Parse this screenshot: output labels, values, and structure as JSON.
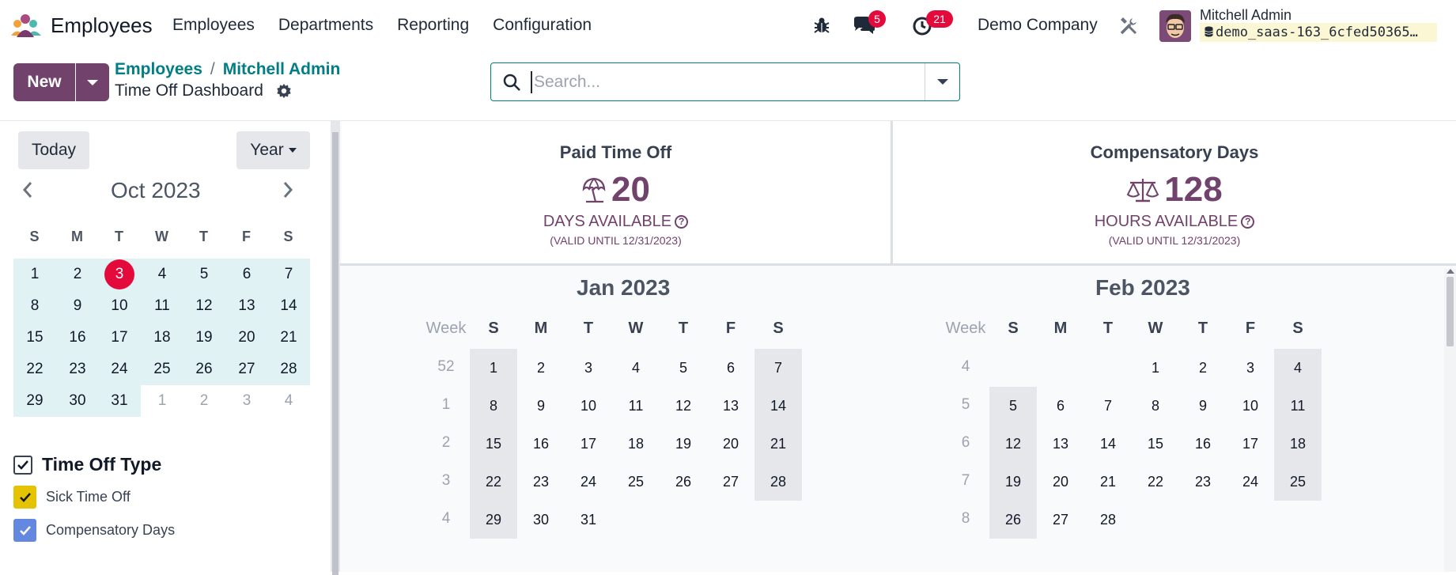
{
  "navbar": {
    "app_name": "Employees",
    "menu": [
      "Employees",
      "Departments",
      "Reporting",
      "Configuration"
    ],
    "messages_count": "5",
    "activities_count": "21",
    "company": "Demo Company",
    "user_name": "Mitchell Admin",
    "database": "demo_saas-163_6cfed50365…"
  },
  "control_panel": {
    "new_label": "New",
    "breadcrumb_parent": "Employees",
    "breadcrumb_sep": "/",
    "breadcrumb_current": "Mitchell Admin",
    "page_title": "Time Off Dashboard",
    "search_placeholder": "Search..."
  },
  "sidebar": {
    "today_label": "Today",
    "scale_label": "Year",
    "mini_month": "Oct 2023",
    "weekdays": [
      "S",
      "M",
      "T",
      "W",
      "T",
      "F",
      "S"
    ],
    "weeks": [
      [
        "1",
        "2",
        "3",
        "4",
        "5",
        "6",
        "7"
      ],
      [
        "8",
        "9",
        "10",
        "11",
        "12",
        "13",
        "14"
      ],
      [
        "15",
        "16",
        "17",
        "18",
        "19",
        "20",
        "21"
      ],
      [
        "22",
        "23",
        "24",
        "25",
        "26",
        "27",
        "28"
      ],
      [
        "29",
        "30",
        "31",
        "1",
        "2",
        "3",
        "4"
      ]
    ],
    "today_day": "3",
    "filter_title": "Time Off Type",
    "filters": [
      {
        "label": "Sick Time Off",
        "color": "#e6c300"
      },
      {
        "label": "Compensatory Days",
        "color": "#6488e0"
      }
    ]
  },
  "stats": [
    {
      "name": "Paid Time Off",
      "value": "20",
      "unit": "DAYS AVAILABLE",
      "valid": "(VALID UNTIL 12/31/2023)",
      "icon": "umbrella-icon"
    },
    {
      "name": "Compensatory Days",
      "value": "128",
      "unit": "HOURS AVAILABLE",
      "valid": "(VALID UNTIL 12/31/2023)",
      "icon": "scale-icon"
    }
  ],
  "calendar": {
    "week_label": "Week",
    "weekdays": [
      "S",
      "M",
      "T",
      "W",
      "T",
      "F",
      "S"
    ],
    "months": [
      {
        "title": "Jan 2023",
        "weeks": [
          {
            "num": "52",
            "days": [
              "1",
              "2",
              "3",
              "4",
              "5",
              "6",
              "7"
            ]
          },
          {
            "num": "1",
            "days": [
              "8",
              "9",
              "10",
              "11",
              "12",
              "13",
              "14"
            ]
          },
          {
            "num": "2",
            "days": [
              "15",
              "16",
              "17",
              "18",
              "19",
              "20",
              "21"
            ]
          },
          {
            "num": "3",
            "days": [
              "22",
              "23",
              "24",
              "25",
              "26",
              "27",
              "28"
            ]
          },
          {
            "num": "4",
            "days": [
              "29",
              "30",
              "31",
              "",
              "",
              "",
              ""
            ]
          }
        ]
      },
      {
        "title": "Feb 2023",
        "weeks": [
          {
            "num": "4",
            "days": [
              "",
              "",
              "",
              "1",
              "2",
              "3",
              "4"
            ]
          },
          {
            "num": "5",
            "days": [
              "5",
              "6",
              "7",
              "8",
              "9",
              "10",
              "11"
            ]
          },
          {
            "num": "6",
            "days": [
              "12",
              "13",
              "14",
              "15",
              "16",
              "17",
              "18"
            ]
          },
          {
            "num": "7",
            "days": [
              "19",
              "20",
              "21",
              "22",
              "23",
              "24",
              "25"
            ]
          },
          {
            "num": "8",
            "days": [
              "26",
              "27",
              "28",
              "",
              "",
              "",
              ""
            ]
          }
        ]
      }
    ]
  },
  "colors": {
    "brand": "#71426c",
    "accent": "#017e84",
    "badge": "#e40a3b"
  }
}
